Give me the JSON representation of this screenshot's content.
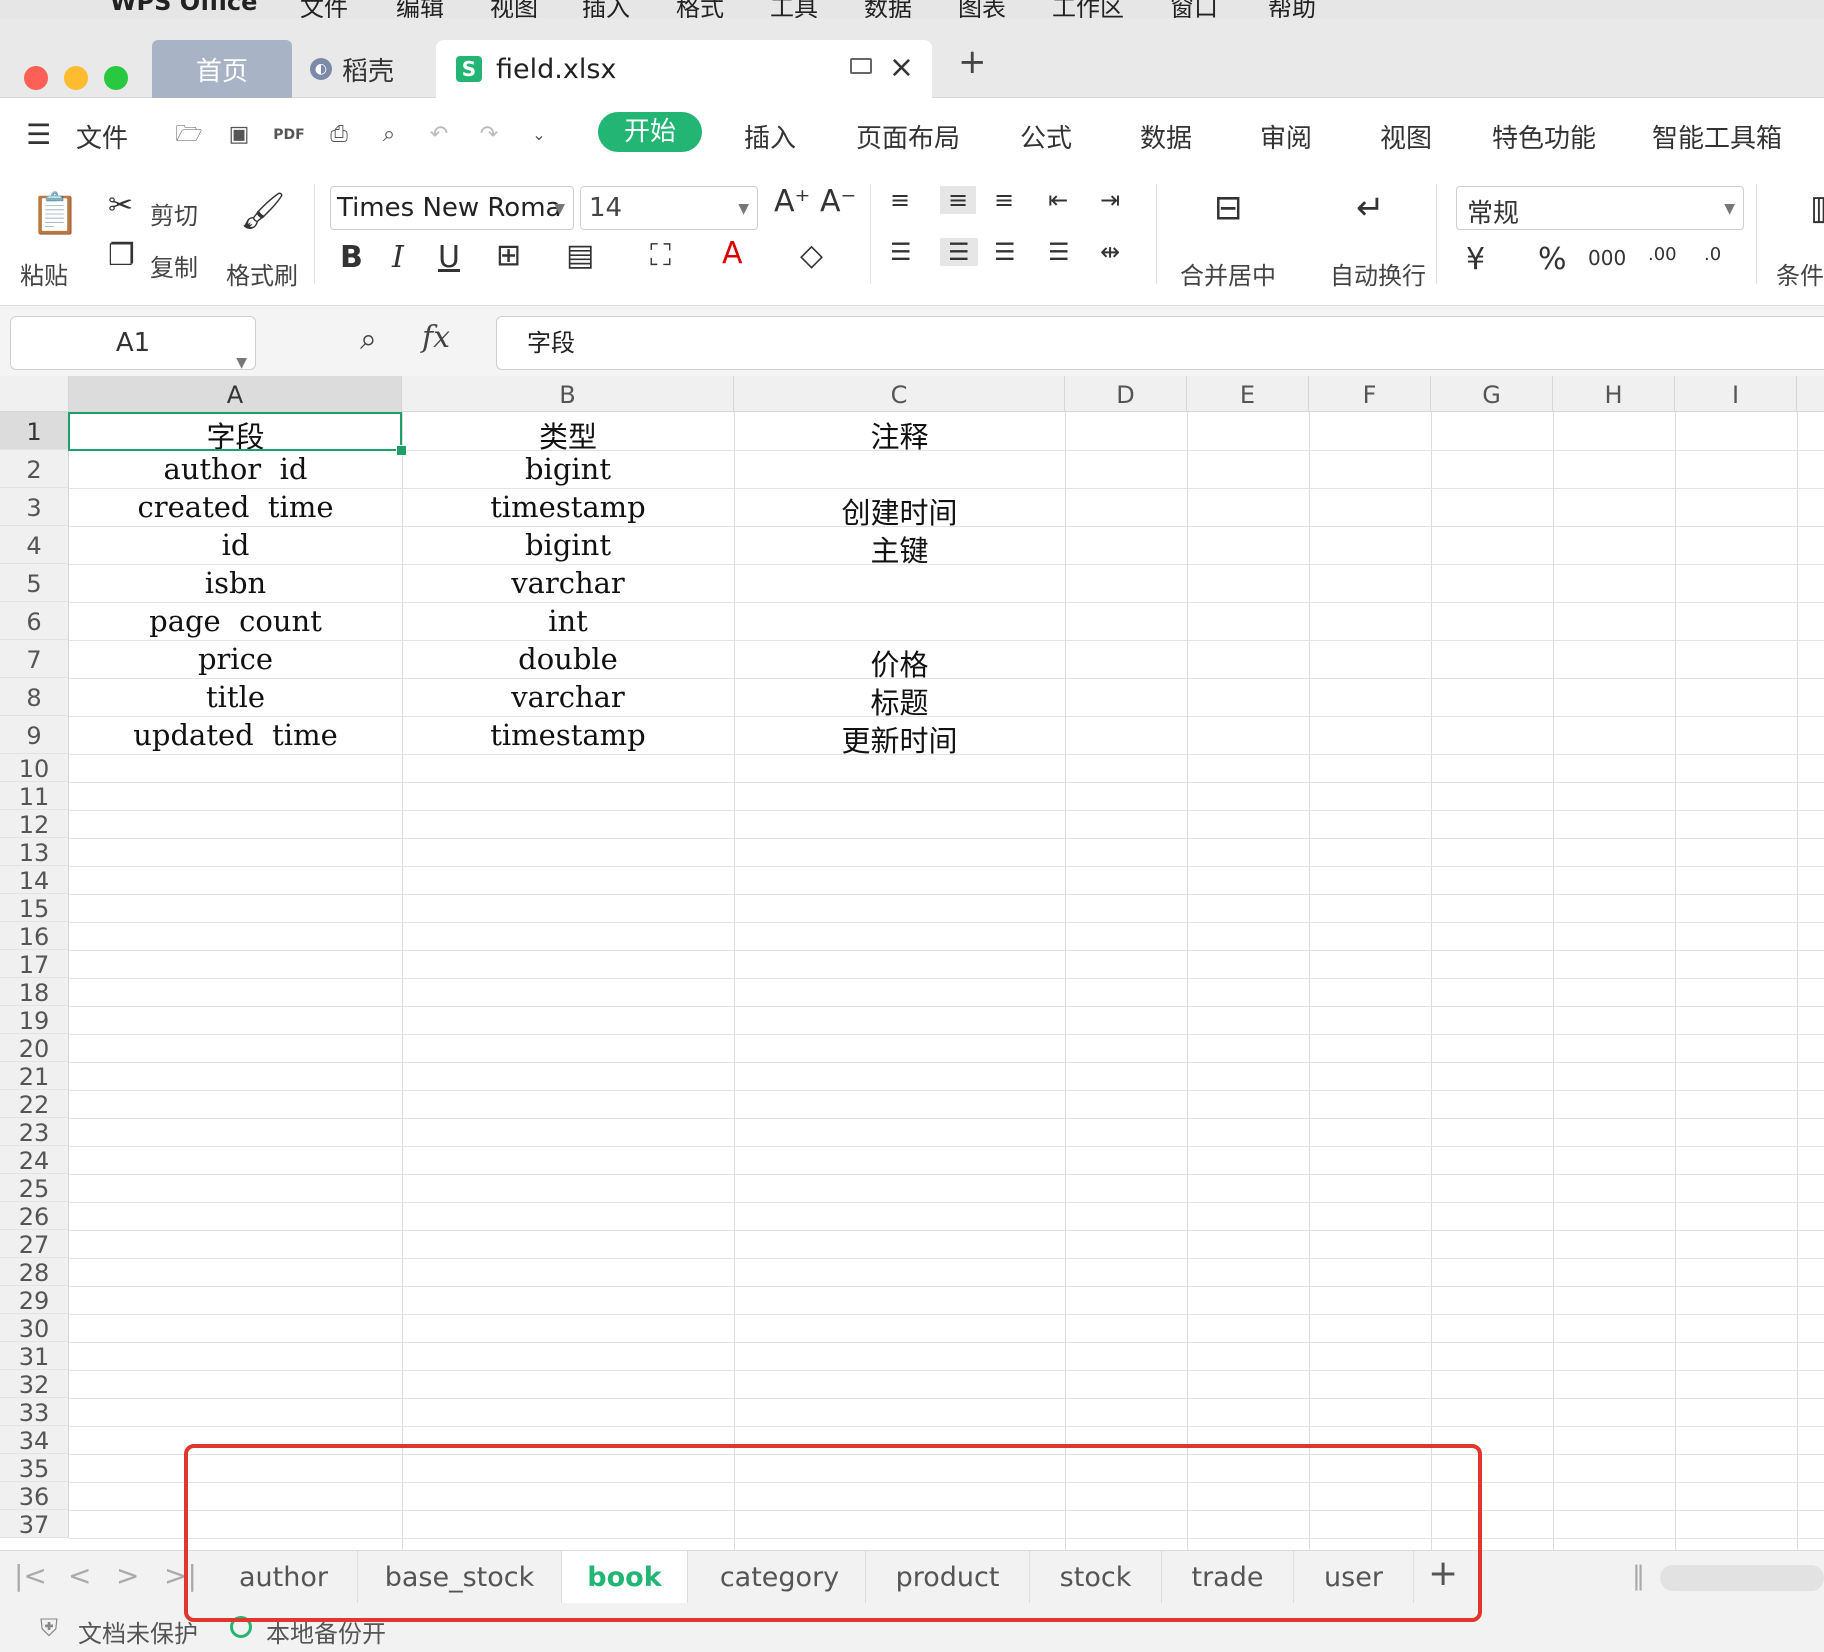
{
  "os_menu": [
    "WPS Office",
    "文件",
    "编辑",
    "视图",
    "插入",
    "格式",
    "工具",
    "数据",
    "图表",
    "工作区",
    "窗口",
    "帮助"
  ],
  "tabs": {
    "home": "首页",
    "docer": "稻壳",
    "file": "field.xlsx"
  },
  "menu": {
    "file": "文件",
    "start": "开始",
    "items": [
      "插入",
      "页面布局",
      "公式",
      "数据",
      "审阅",
      "视图",
      "特色功能",
      "智能工具箱"
    ]
  },
  "ribbon": {
    "paste": "粘贴",
    "cut": "剪切",
    "copy": "复制",
    "format_painter": "格式刷",
    "font": "Times New Roma",
    "size": "14",
    "merge": "合并居中",
    "wrap": "自动换行",
    "number_format": "常规",
    "conditional": "条件"
  },
  "formula_bar": {
    "cell_ref": "A1",
    "content": "字段"
  },
  "columns": [
    "A",
    "B",
    "C",
    "D",
    "E",
    "F",
    "G",
    "H",
    "I"
  ],
  "rows": [
    {
      "n": "1",
      "a": "字段",
      "b": "类型",
      "c": "注释"
    },
    {
      "n": "2",
      "a": "author  id",
      "b": "bigint",
      "c": ""
    },
    {
      "n": "3",
      "a": "created  time",
      "b": "timestamp",
      "c": "创建时间"
    },
    {
      "n": "4",
      "a": "id",
      "b": "bigint",
      "c": "主键"
    },
    {
      "n": "5",
      "a": "isbn",
      "b": "varchar",
      "c": ""
    },
    {
      "n": "6",
      "a": "page  count",
      "b": "int",
      "c": ""
    },
    {
      "n": "7",
      "a": "price",
      "b": "double",
      "c": "价格"
    },
    {
      "n": "8",
      "a": "title",
      "b": "varchar",
      "c": "标题"
    },
    {
      "n": "9",
      "a": "updated  time",
      "b": "timestamp",
      "c": "更新时间"
    }
  ],
  "empty_rows": [
    "10",
    "11",
    "12",
    "13",
    "14",
    "15",
    "16",
    "17",
    "18",
    "19",
    "20",
    "21",
    "22",
    "23",
    "24",
    "25",
    "26",
    "27",
    "28",
    "29",
    "30",
    "31",
    "32",
    "33",
    "34",
    "35",
    "36",
    "37"
  ],
  "sheets": [
    "author",
    "base_stock",
    "book",
    "category",
    "product",
    "stock",
    "trade",
    "user"
  ],
  "active_sheet": "book",
  "status": {
    "protect": "文档未保护",
    "backup": "本地备份开"
  },
  "colors": {
    "accent": "#22b573",
    "highlight": "#e0362c"
  }
}
